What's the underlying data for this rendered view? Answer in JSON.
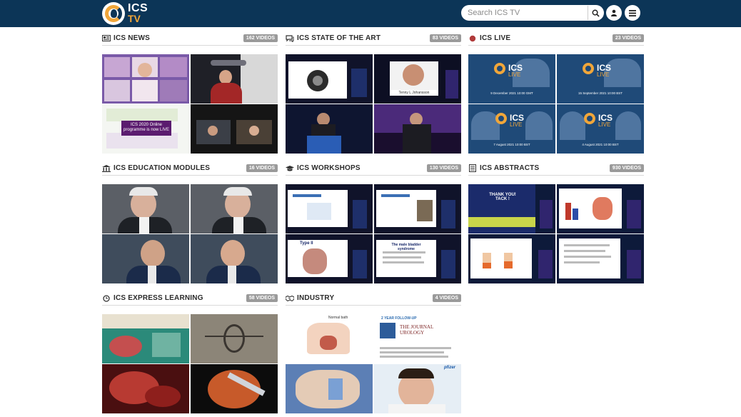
{
  "header": {
    "logo_line1": "ICS",
    "logo_line2": "TV",
    "search_placeholder": "Search ICS TV",
    "icons": [
      "search-icon",
      "user-icon",
      "menu-icon"
    ]
  },
  "colors": {
    "header_bg": "#0c3557",
    "accent": "#f0a63a",
    "badge_bg": "#9a9a9a",
    "live_dot": "#b03a3a"
  },
  "sections": [
    {
      "title": "ICS NEWS",
      "count": "162 VIDEOS",
      "icon": "newspaper-icon"
    },
    {
      "title": "ICS STATE OF THE ART",
      "count": "83 VIDEOS",
      "icon": "chat-icon"
    },
    {
      "title": "ICS LIVE",
      "count": "23 VIDEOS",
      "icon": "live-dot-icon"
    },
    {
      "title": "ICS EDUCATION MODULES",
      "count": "16 VIDEOS",
      "icon": "institution-icon"
    },
    {
      "title": "ICS WORKSHOPS",
      "count": "130 VIDEOS",
      "icon": "graduation-cap-icon"
    },
    {
      "title": "ICS ABSTRACTS",
      "count": "930 VIDEOS",
      "icon": "document-icon"
    },
    {
      "title": "ICS EXPRESS LEARNING",
      "count": "58 VIDEOS",
      "icon": "clock-icon"
    },
    {
      "title": "INDUSTRY",
      "count": "4 VIDEOS",
      "icon": "handshake-icon"
    }
  ],
  "thumbnails": {
    "news_slide": "ICS 2020 Online programme is now LIVE",
    "live_logo_text": "ICS",
    "live_logo_sub": "LIVE",
    "live_dates": [
      "9 December 2021 10:00 GMT",
      "15 September 2021 10:00 BST",
      "7 August 2021 10:00 BST",
      "4 August 2021 10:00 BST"
    ],
    "abstract_slide_title": "THANK YOU! TACK !",
    "workshop_slide_title": "The male bladder syndrome",
    "workshop_slide_title2": "Type II",
    "industry_journal": "THE JOURNAL UROLOGY",
    "industry_followup": "2 YEAR FOLLOW-UP",
    "industry_brand": "pfizer",
    "industry_diagram_label": "Normal bath",
    "sota_caption": "Tenny L Johansson"
  }
}
